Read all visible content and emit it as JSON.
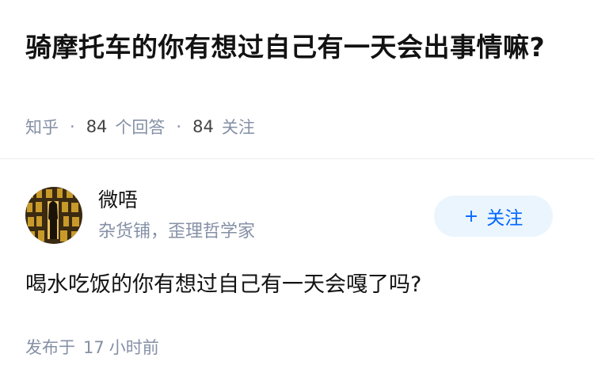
{
  "question": {
    "title": "骑摩托车的你有想过自己有一天会出事情嘛?",
    "source": "知乎",
    "answer_count": "84",
    "answer_label": "个回答",
    "follow_count": "84",
    "follow_label": "关注"
  },
  "author": {
    "name": "微唔",
    "bio": "杂货铺，歪理哲学家",
    "follow_button_label": "关注",
    "follow_button_icon": "plus-icon"
  },
  "answer": {
    "text": "喝水吃饭的你有想过自己有一天会嘎了吗?",
    "time_prefix": "发布于",
    "time_value": "17",
    "time_unit": "小时前"
  },
  "colors": {
    "accent": "#0066ff",
    "follow_bg": "#ebf5fd",
    "meta_gray": "#8590a6"
  }
}
